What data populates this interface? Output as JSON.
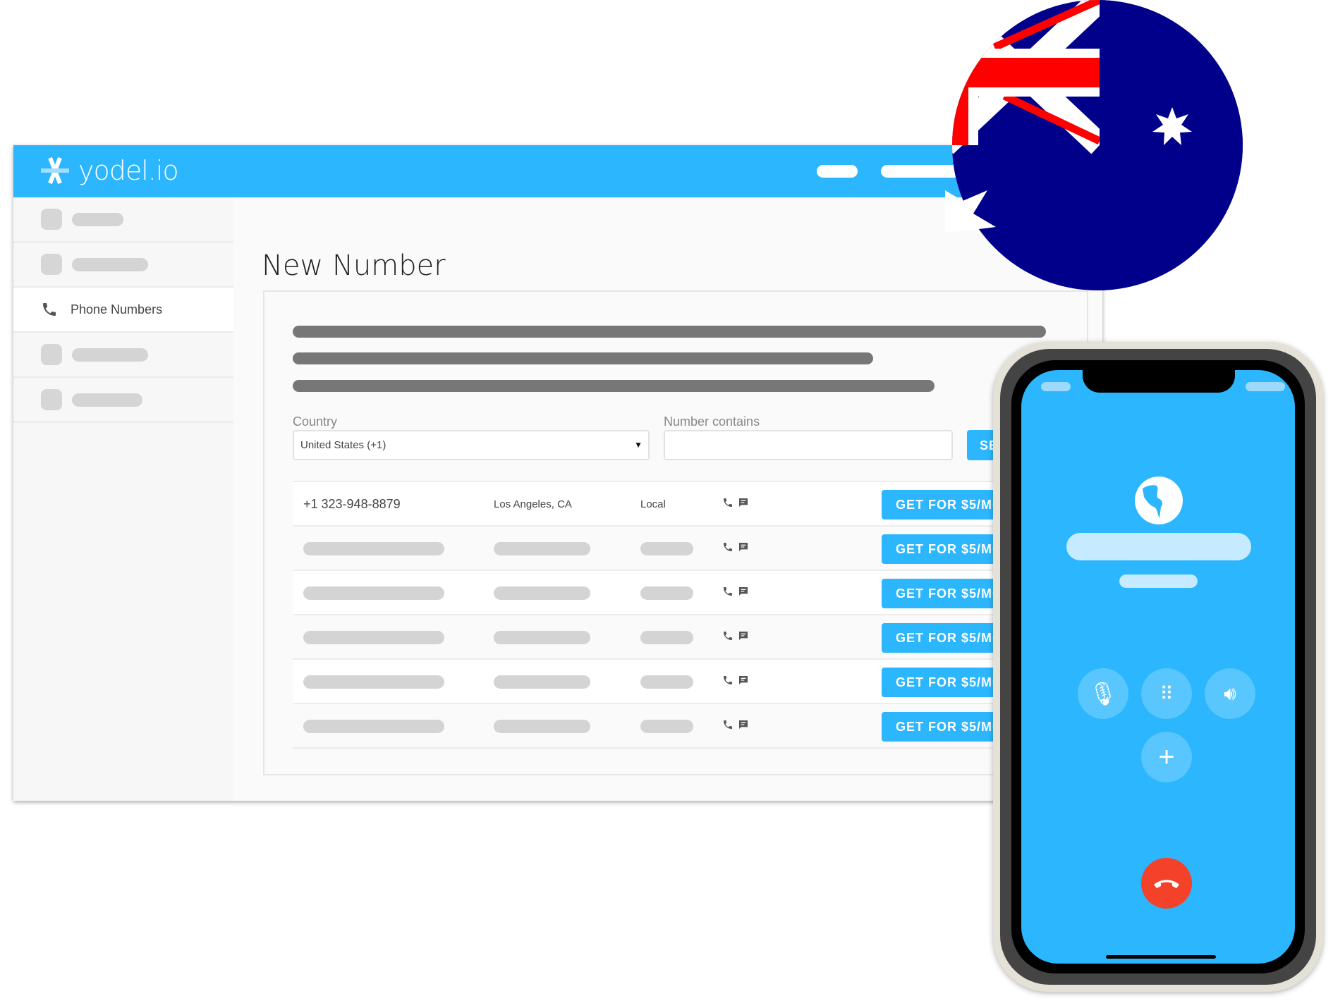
{
  "app": {
    "brand": "yodel.io"
  },
  "sidebar": {
    "active_item": "Phone Numbers"
  },
  "page": {
    "title": "New Number"
  },
  "form": {
    "country_label": "Country",
    "country_value": "United States (+1)",
    "number_label": "Number contains",
    "number_value": "",
    "search_label": "SEARCH"
  },
  "results": [
    {
      "number": "+1 323-948-8879",
      "location": "Los Angeles, CA",
      "type": "Local",
      "button": "GET FOR $5/MO"
    },
    {
      "button": "GET FOR $5/MO"
    },
    {
      "button": "GET FOR $5/MO"
    },
    {
      "button": "GET FOR $5/MO"
    },
    {
      "button": "GET FOR $5/MO"
    },
    {
      "button": "GET FOR $5/MO"
    }
  ],
  "colors": {
    "brand": "#2bb6fd",
    "flag_blue": "#00008b",
    "flag_red": "#ff0000",
    "end_call": "#f4412a"
  },
  "icons": [
    "logo-icon",
    "phone-icon",
    "sms-icon",
    "dropdown-caret-icon",
    "globe-icon",
    "mic-icon",
    "keypad-icon",
    "speaker-icon",
    "add-call-icon",
    "end-call-icon",
    "australia-flag"
  ]
}
